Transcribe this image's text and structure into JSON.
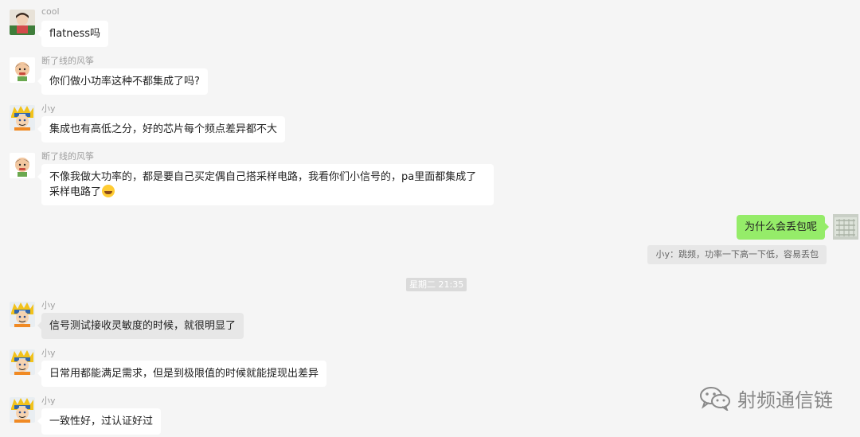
{
  "messages": [
    {
      "name": "cool",
      "text": "flatness吗"
    },
    {
      "name": "断了线的风筝",
      "text": "你们做小功率这种不都集成了吗?"
    },
    {
      "name": "小y",
      "text": "集成也有高低之分，好的芯片每个频点差异都不大"
    },
    {
      "name": "断了线的风筝",
      "text": "不像我做大功率的，都是要自己买定偶自己搭采样电路，我看你们小信号的，pa里面都集成了采样电路了"
    },
    {
      "name": "小y",
      "text": "信号测试接收灵敏度的时候，就很明显了"
    },
    {
      "name": "小y",
      "text": "日常用都能满足需求，但是到极限值的时候就能提现出差异"
    },
    {
      "name": "小y",
      "text": "一致性好，过认证好过"
    }
  ],
  "self_message": {
    "text": "为什么会丢包呢"
  },
  "quote": {
    "text": "小y：跳频，功率一下高一下低，容易丢包"
  },
  "timestamp": "星期二 21:35",
  "watermark": {
    "text": "射频通信链",
    "icon": "wechat-icon"
  },
  "colors": {
    "self_bubble": "#95ec69",
    "other_bubble": "#ffffff",
    "background": "#f5f5f5"
  }
}
